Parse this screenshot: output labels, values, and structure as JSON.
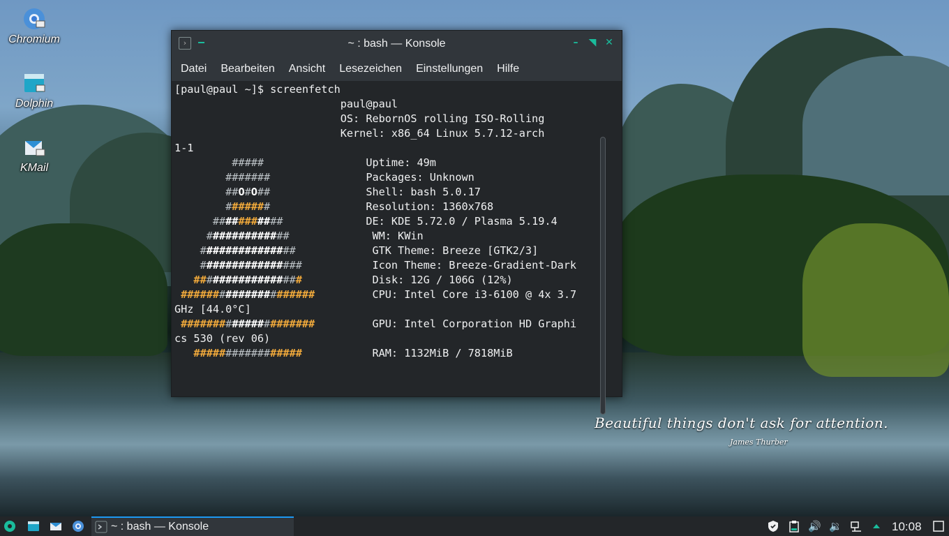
{
  "desktop": {
    "icons": [
      {
        "label": "Chromium",
        "icon": "chromium-icon"
      },
      {
        "label": "Dolphin",
        "icon": "folder-icon"
      },
      {
        "label": "KMail",
        "icon": "mail-icon"
      }
    ],
    "quote": "Beautiful things don't ask for attention.",
    "quote_author": "James Thurber"
  },
  "window": {
    "title": "~ : bash — Konsole",
    "menu": [
      "Datei",
      "Bearbeiten",
      "Ansicht",
      "Lesezeichen",
      "Einstellungen",
      "Hilfe"
    ],
    "prompt": "[paul@paul ~]$ screenfetch",
    "info": {
      "user": "paul@paul",
      "os": "OS: RebornOS rolling ISO-Rolling",
      "kernel_1": "Kernel: x86_64 Linux 5.7.12-arch",
      "kernel_2": "1-1",
      "uptime": "Uptime: 49m",
      "packages": "Packages: Unknown",
      "shell": "Shell: bash 5.0.17",
      "resolution": "Resolution: 1360x768",
      "de": "DE: KDE 5.72.0 / Plasma 5.19.4",
      "wm": "WM: KWin",
      "gtk": "GTK Theme: Breeze [GTK2/3]",
      "icon_theme": "Icon Theme: Breeze-Gradient-Dark",
      "disk": "Disk: 12G / 106G (12%)",
      "cpu_1": "CPU: Intel Core i3-6100 @ 4x 3.7",
      "cpu_2": "GHz [44.0°C]",
      "gpu_1": "GPU: Intel Corporation HD Graphi",
      "gpu_2": "cs 530 (rev 06)",
      "ram": "RAM: 1132MiB / 7818MiB"
    }
  },
  "taskbar": {
    "task_label": "~ : bash — Konsole",
    "clock": "10:08"
  },
  "colors": {
    "accent": "#1abc9c",
    "logo_orange": "#f0a93b",
    "taskbar_highlight": "#1d99f3"
  }
}
